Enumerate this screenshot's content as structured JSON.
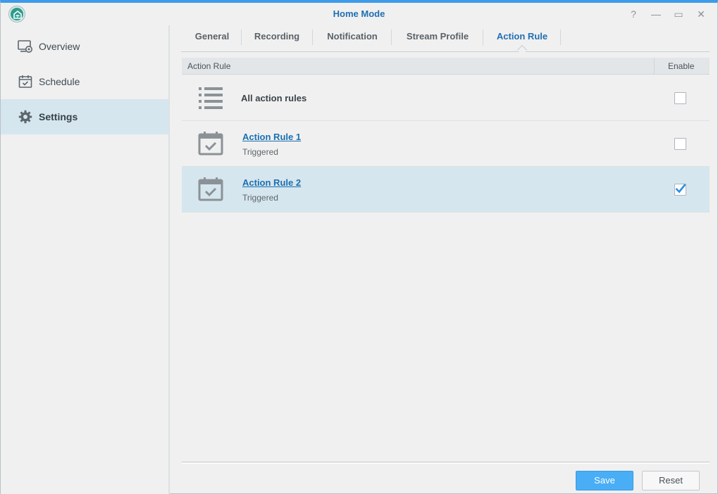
{
  "window": {
    "title": "Home Mode",
    "controls": {
      "help": "?",
      "minimize": "—",
      "maximize": "▭",
      "close": "✕"
    }
  },
  "sidebar": {
    "items": [
      {
        "label": "Overview",
        "icon": "monitor-camera-icon"
      },
      {
        "label": "Schedule",
        "icon": "calendar-icon"
      },
      {
        "label": "Settings",
        "icon": "gear-icon",
        "active": true
      }
    ]
  },
  "tabs": [
    {
      "label": "General"
    },
    {
      "label": "Recording"
    },
    {
      "label": "Notification"
    },
    {
      "label": "Stream Profile"
    },
    {
      "label": "Action Rule",
      "active": true
    }
  ],
  "grid": {
    "columns": {
      "name": "Action Rule",
      "enable": "Enable"
    },
    "rows": [
      {
        "title": "All action rules",
        "icon": "list-icon",
        "enabled": false
      },
      {
        "title": "Action Rule 1",
        "status": "Triggered",
        "icon": "calendar-check-icon",
        "enabled": false,
        "link": true
      },
      {
        "title": "Action Rule 2",
        "status": "Triggered",
        "icon": "calendar-check-icon",
        "enabled": true,
        "link": true,
        "selected": true
      }
    ]
  },
  "buttons": {
    "save": "Save",
    "reset": "Reset"
  },
  "colors": {
    "accent": "#1f6fb2",
    "primary_button": "#49aef5",
    "selection": "#d6e6ee",
    "checkmark": "#2b8de4"
  }
}
